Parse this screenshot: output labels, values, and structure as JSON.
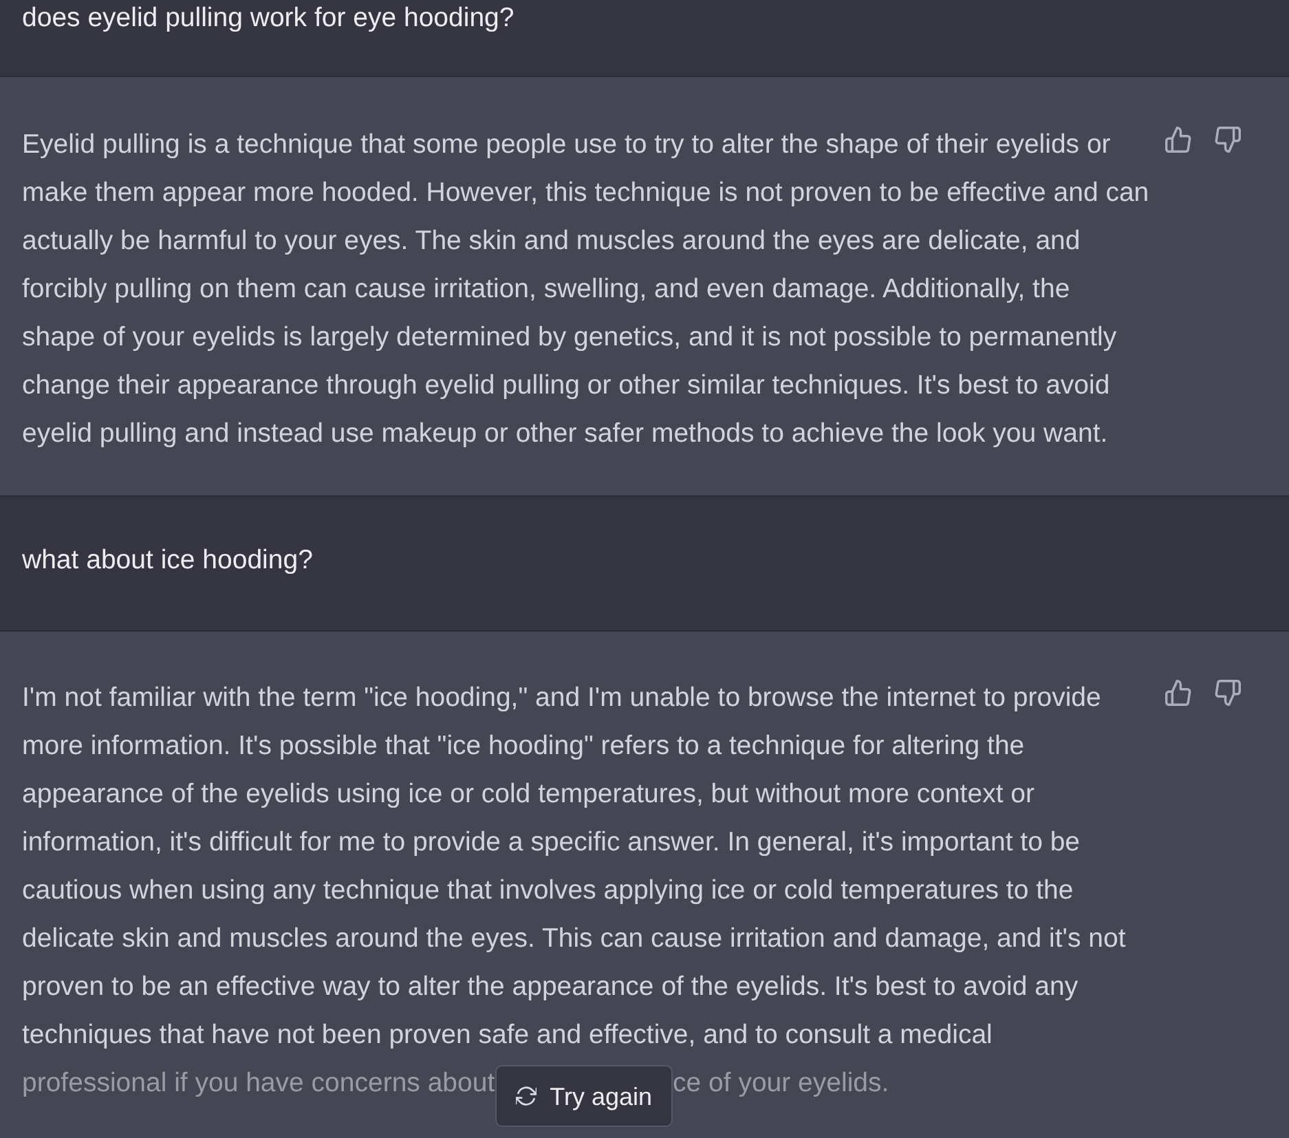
{
  "conversation": [
    {
      "kind": "user",
      "text": "does eyelid pulling work for eye hooding?"
    },
    {
      "kind": "assistant",
      "text": "Eyelid pulling is a technique that some people use to try to alter the shape of their eyelids or make them appear more hooded. However, this technique is not proven to be effective and can actually be harmful to your eyes. The skin and muscles around the eyes are delicate, and forcibly pulling on them can cause irritation, swelling, and even damage. Additionally, the shape of your eyelids is largely determined by genetics, and it is not possible to permanently change their appearance through eyelid pulling or other similar techniques. It's best to avoid eyelid pulling and instead use makeup or other safer methods to achieve the look you want."
    },
    {
      "kind": "user",
      "text": "what about ice hooding?"
    },
    {
      "kind": "assistant",
      "text": "I'm not familiar with the term \"ice hooding,\" and I'm unable to browse the internet to provide more information. It's possible that \"ice hooding\" refers to a technique for altering the appearance of the eyelids using ice or cold temperatures, but without more context or information, it's difficult for me to provide a specific answer. In general, it's important to be cautious when using any technique that involves applying ice or cold temperatures to the delicate skin and muscles around the eyes. This can cause irritation and damage, and it's not proven to be an effective way to alter the appearance of the eyelids. It's best to avoid any techniques that have not been proven safe and effective, and to consult a medical",
      "last_line": {
        "before_button": "professional if you have concerns about",
        "try_again_button": {
          "label": "Try again"
        },
        "after_button": "ce of your eyelids."
      }
    }
  ]
}
